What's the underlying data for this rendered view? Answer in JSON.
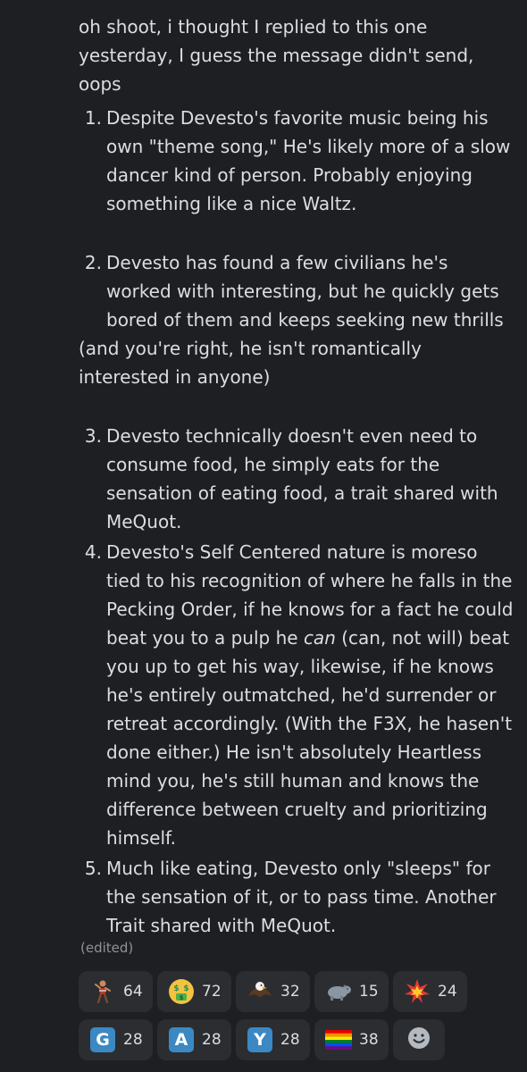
{
  "message": {
    "intro": "oh shoot, i thought I replied to this one yesterday, I guess the message didn't send, oops",
    "items": [
      {
        "number": "1.",
        "text": "Despite Devesto's favorite music being his own \"theme song,\" He's likely more of a slow dancer kind of person. Probably enjoying something like a nice Waltz."
      },
      {
        "number": "2.",
        "text": "Devesto has found a few civilians he's worked with interesting, but he quickly gets bored of them and keeps seeking new thrills",
        "continuation": "(and you're right, he isn't romantically interested in anyone)"
      },
      {
        "number": "3.",
        "text": "Devesto technically doesn't even need to consume food, he simply eats for the sensation of eating food, a trait shared with MeQuot."
      },
      {
        "number": "4.",
        "text_before": "Devesto's Self Centered nature is moreso tied to his recognition of where he falls in the Pecking Order, if he knows for a fact he could beat you to a pulp he ",
        "text_emph": "can",
        "text_after": " (can, not will) beat you up to get his way, likewise, if he knows he's entirely outmatched, he'd surrender or retreat accordingly. (With the F3X, he hasen't done either.) He isn't absolutely Heartless mind you, he's still human and knows the difference between cruelty and prioritizing himself."
      },
      {
        "number": "5.",
        "text": "Much like eating, Devesto only \"sleeps\" for the sensation of it, or to pass time. Another Trait shared with MeQuot."
      }
    ],
    "edited_label": "(edited)"
  },
  "reactions": [
    {
      "icon": "dancing-figure-icon",
      "count": "64"
    },
    {
      "icon": "money-mouth-face-icon",
      "count": "72"
    },
    {
      "icon": "eagle-icon",
      "count": "32"
    },
    {
      "icon": "hippopotamus-icon",
      "count": "15"
    },
    {
      "icon": "collision-icon",
      "count": "24"
    },
    {
      "icon": "letter-g-icon",
      "letter": "G",
      "count": "28"
    },
    {
      "icon": "letter-a-icon",
      "letter": "A",
      "count": "28"
    },
    {
      "icon": "letter-y-icon",
      "letter": "Y",
      "count": "28"
    },
    {
      "icon": "rainbow-flag-icon",
      "count": "38"
    }
  ],
  "colors": {
    "background": "#1e1f22",
    "text": "#dbdee1",
    "reaction_bg": "#2b2d31",
    "muted": "#8e9297",
    "letter_badge": "#3b88c3"
  }
}
